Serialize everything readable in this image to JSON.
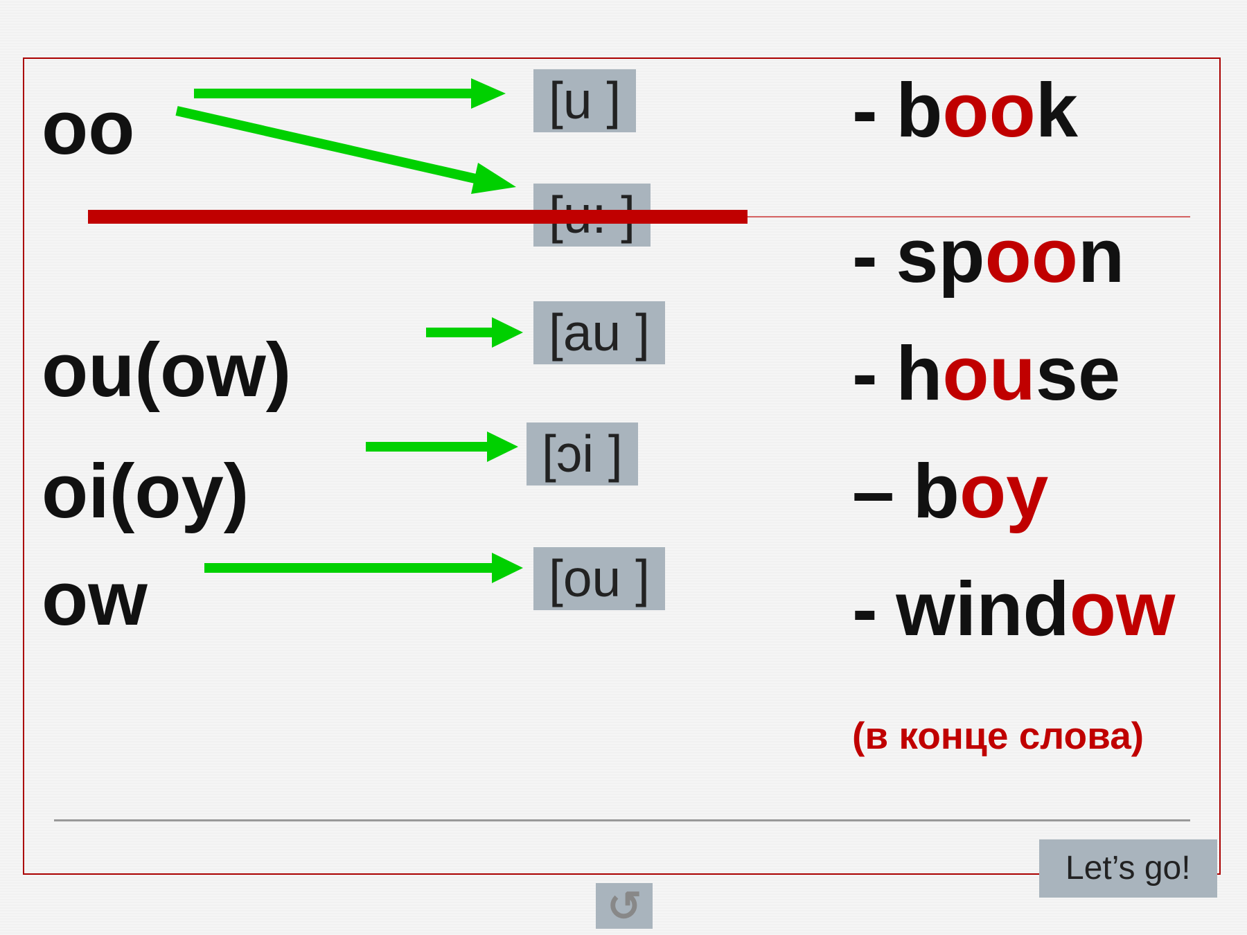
{
  "letters": {
    "oo": "oo",
    "ou_ow": "ou(ow)",
    "oi_oy": "oi(oy)",
    "ow": "ow"
  },
  "phonetics": {
    "u_short": "[u ]",
    "u_long": "[u: ]",
    "au": "[au ]",
    "oi": "[ɔi ]",
    "ou": "[ou ]"
  },
  "examples": {
    "book": {
      "dash": "- ",
      "pre": "b",
      "hl": "oo",
      "post": "k"
    },
    "spoon": {
      "dash": "- ",
      "pre": "sp",
      "hl": "oo",
      "post": "n"
    },
    "house": {
      "dash": "- ",
      "pre": "h",
      "hl": "ou",
      "post": "se"
    },
    "boy": {
      "dash": "– ",
      "pre": "b",
      "hl": "oy",
      "post": ""
    },
    "window": {
      "dash": "- ",
      "pre": "wind",
      "hl": "ow",
      "post": ""
    }
  },
  "note": "(в конце слова)",
  "button": "Let’s go!",
  "return_glyph": "↺"
}
